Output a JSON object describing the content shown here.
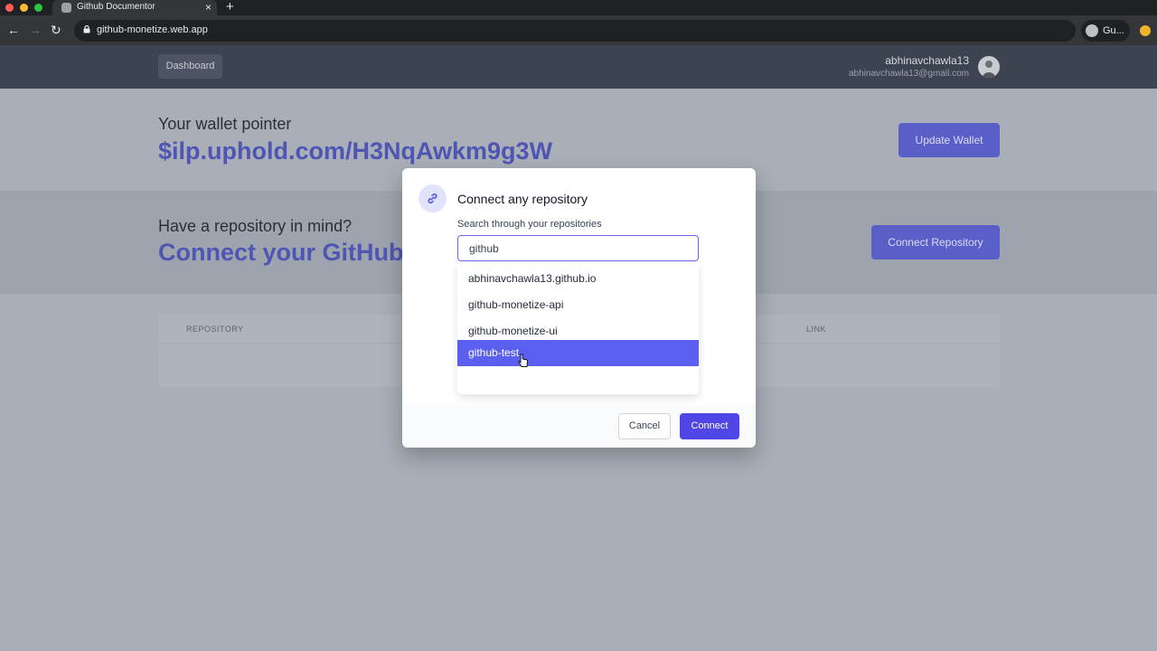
{
  "browser": {
    "tab_title": "Github Documentor",
    "url": "github-monetize.web.app",
    "profile_label": "Gu...",
    "traffic_colors": [
      "#ff5f57",
      "#febc2e",
      "#28c840"
    ]
  },
  "header": {
    "dashboard_label": "Dashboard",
    "user_name": "abhinavchawla13",
    "user_email": "abhinavchawla13@gmail.com"
  },
  "wallet": {
    "label": "Your wallet pointer",
    "pointer": "$ilp.uphold.com/H3NqAwkm9g3W",
    "update_button": "Update Wallet"
  },
  "repo_section": {
    "label": "Have a repository in mind?",
    "cta": "Connect your GitHub",
    "connect_button": "Connect Repository"
  },
  "table": {
    "columns": [
      "REPOSITORY",
      "LINK"
    ]
  },
  "modal": {
    "title": "Connect any repository",
    "search_label": "Search through your repositories",
    "search_value": "github",
    "options": [
      "abhinavchawla13.github.io",
      "github-monetize-api",
      "github-monetize-ui",
      "github-test"
    ],
    "selected_option": "github-test",
    "cancel_label": "Cancel",
    "connect_label": "Connect"
  },
  "colors": {
    "accent": "#4f46e5",
    "highlight": "#5a5ff0",
    "header_bg": "#3c4452"
  }
}
